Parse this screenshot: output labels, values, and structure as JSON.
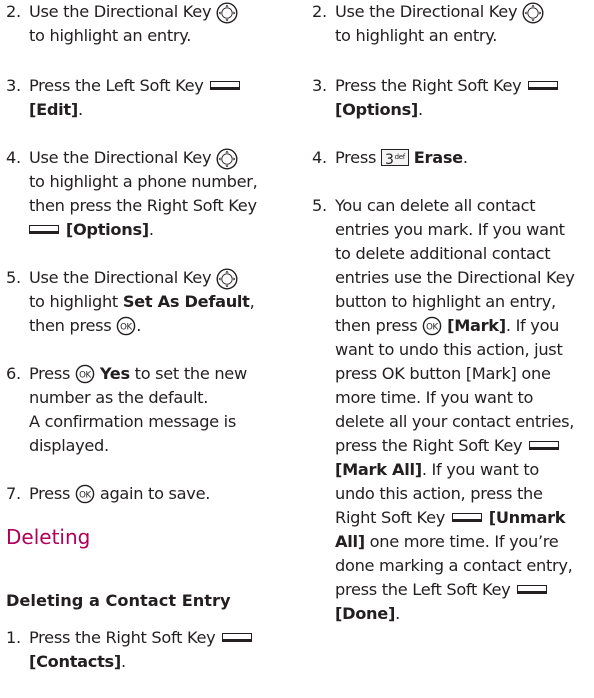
{
  "left": {
    "step2": {
      "num": "2.",
      "text_a": "Use the Directional Key",
      "text_b": "to highlight an entry."
    },
    "step3": {
      "num": "3.",
      "text_a": "Press the Left Soft Key",
      "bold_b": "[Edit]",
      "tail_b": "."
    },
    "step4": {
      "num": "4.",
      "text_a": "Use the Directional Key",
      "text_b": "to highlight a phone number,",
      "text_c": "then press the Right Soft Key",
      "bold_d": "[Options]",
      "tail_d": "."
    },
    "step5": {
      "num": "5.",
      "text_a": "Use the Directional Key",
      "text_b1": "to highlight ",
      "bold_b": "Set As Default",
      "tail_b": ",",
      "text_c": "then press",
      "tail_c": "."
    },
    "step6": {
      "num": "6.",
      "text_a1": "Press",
      "bold_a": "Yes",
      "text_a2": "to set the new",
      "text_b": "number as the default.",
      "text_c": "A confirmation message is",
      "text_d": "displayed."
    },
    "step7": {
      "num": "7.",
      "text_a1": "Press",
      "text_a2": "again to save."
    },
    "heading": "Deleting",
    "subheading": "Deleting a Contact Entry",
    "step1": {
      "num": "1.",
      "text_a": "Press the Right Soft Key",
      "bold_b": "[Contacts]",
      "tail_b": "."
    }
  },
  "right": {
    "step2": {
      "num": "2.",
      "text_a": "Use the Directional Key",
      "text_b": "to highlight an entry."
    },
    "step3": {
      "num": "3.",
      "text_a": "Press the Right Soft Key",
      "bold_b": "[Options]",
      "tail_b": "."
    },
    "step4": {
      "num": "4.",
      "text_a": "Press",
      "key_digit": "3",
      "key_letters": "def",
      "bold_a": "Erase",
      "tail_a": "."
    },
    "step5": {
      "num": "5.",
      "l1": "You can delete all contact",
      "l2": "entries you mark. If you want",
      "l3": "to delete additional contact",
      "l4": "entries use the Directional Key",
      "l5": "button to highlight an entry,",
      "l6a": "then press",
      "l6b": "[Mark]",
      "l6c": ". If you",
      "l7": "want to undo this action, just",
      "l8": "press OK button [Mark] one",
      "l9": "more time. If you want to",
      "l10": "delete all your contact entries,",
      "l11": "press the Right Soft Key",
      "l12a": "[Mark All]",
      "l12b": ". If you want to",
      "l13": "undo this action, press the",
      "l14a": "Right Soft Key",
      "l14b": "[Unmark",
      "l15a": "All]",
      "l15b": " one more time. If you’re",
      "l16": "done marking a contact entry,",
      "l17": "press the Left Soft Key",
      "l18a": "[Done]",
      "l18b": "."
    }
  },
  "icons": {
    "directional": "directional-key-icon",
    "ok": "ok-key-icon",
    "soft_left": "left-soft-key-icon",
    "soft_right": "right-soft-key-icon",
    "keypad": "keypad-3-icon"
  },
  "colors": {
    "heading": "#b0005a",
    "text": "#231f20"
  }
}
